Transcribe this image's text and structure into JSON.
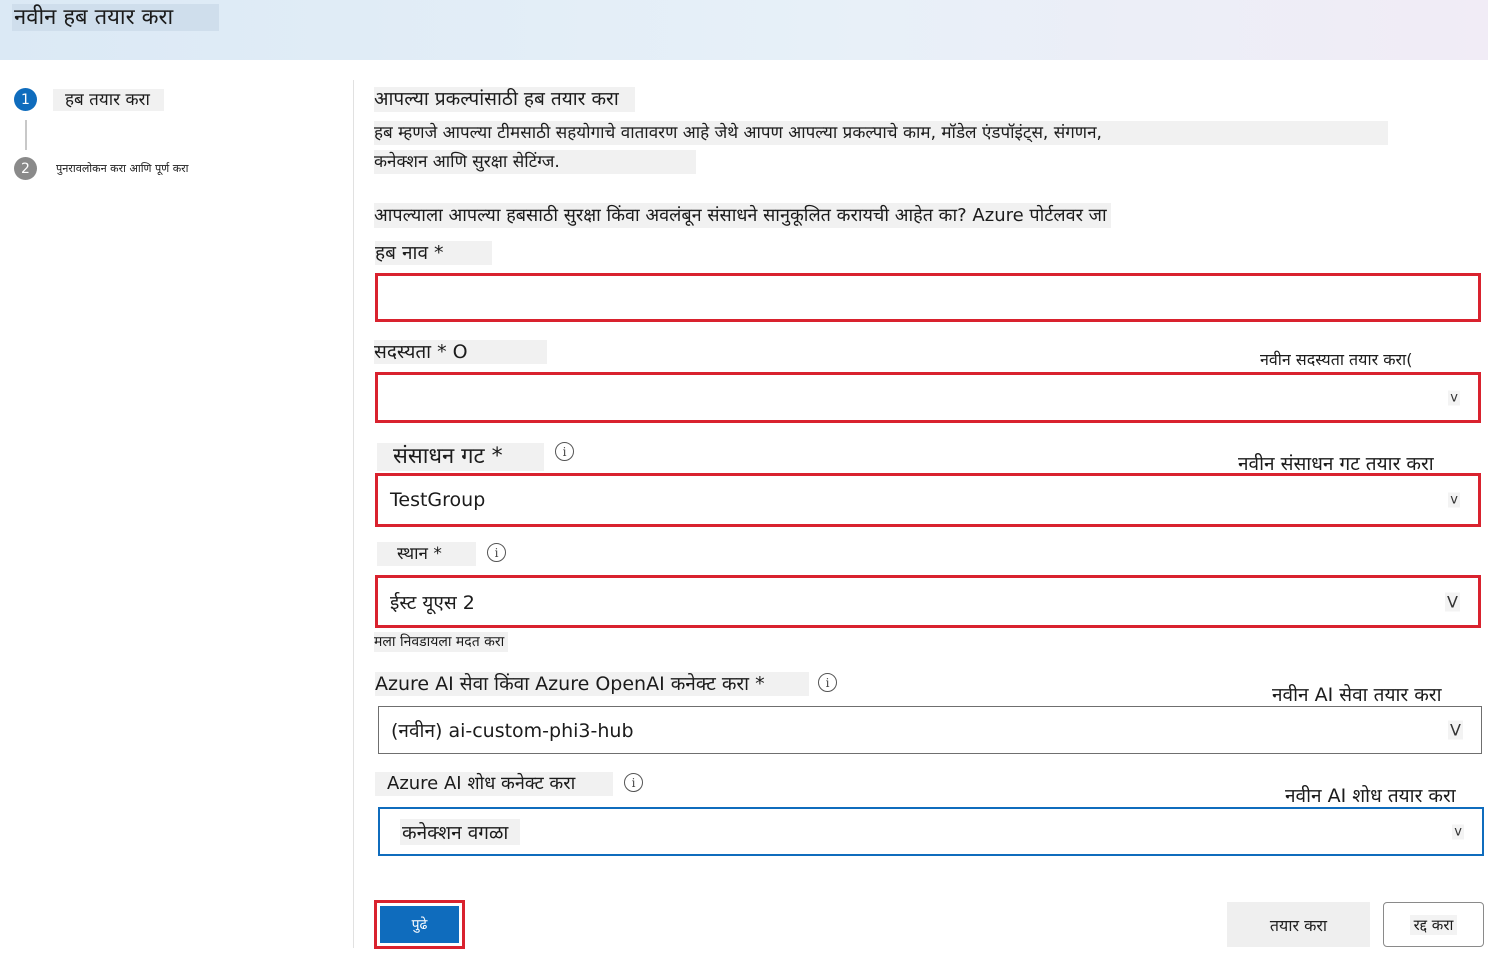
{
  "header": {
    "title": "नवीन हब तयार करा"
  },
  "colors": {
    "accent": "#0f6cbd",
    "highlight_border": "#d9222e",
    "inactive_step": "#8a8a8a"
  },
  "steps": [
    {
      "number": "1",
      "label": "हब तयार करा",
      "active": true
    },
    {
      "number": "2",
      "label": "पुनरावलोकन करा आणि पूर्ण करा",
      "active": false
    }
  ],
  "intro": {
    "heading": "आपल्या प्रकल्पांसाठी हब तयार करा",
    "description_line1": "हब म्हणजे आपल्या टीमसाठी सहयोगाचे वातावरण आहे जेथे आपण आपल्या प्रकल्पाचे काम, मॉडेल एंडपॉइंट्स, संगणन,",
    "description_line2": "कनेक्शन आणि सुरक्षा सेटिंग्ज.",
    "security_note": "आपल्याला आपल्या हबसाठी सुरक्षा किंवा अवलंबून संसाधने सानुकूलित करायची आहेत का? Azure पोर्टलवर जा"
  },
  "form": {
    "hub_name": {
      "label": "हब नाव *",
      "value": ""
    },
    "subscription": {
      "label": "सदस्यता * O",
      "value": "",
      "create_link": "नवीन सदस्यता तयार करा(",
      "chevron": "v"
    },
    "resource_group": {
      "label": "संसाधन गट *",
      "value": "TestGroup",
      "create_link": "नवीन संसाधन गट तयार करा",
      "chevron": "v"
    },
    "location": {
      "label": "स्थान *",
      "value": "ईस्ट यूएस 2",
      "help_link": "मला निवडायला मदत करा",
      "chevron": "V"
    },
    "ai_services": {
      "label": "Azure AI सेवा किंवा Azure OpenAI कनेक्ट करा *",
      "value": "(नवीन) ai-custom-phi3-hub",
      "create_link": "नवीन AI सेवा तयार करा",
      "chevron": "V"
    },
    "ai_search": {
      "label": "Azure AI शोध कनेक्ट करा",
      "value": "कनेक्शन वगळा",
      "create_link": "नवीन AI शोध तयार करा",
      "chevron": "v"
    }
  },
  "buttons": {
    "next": "पुढे",
    "create": "तयार करा",
    "cancel": "रद्द करा"
  }
}
